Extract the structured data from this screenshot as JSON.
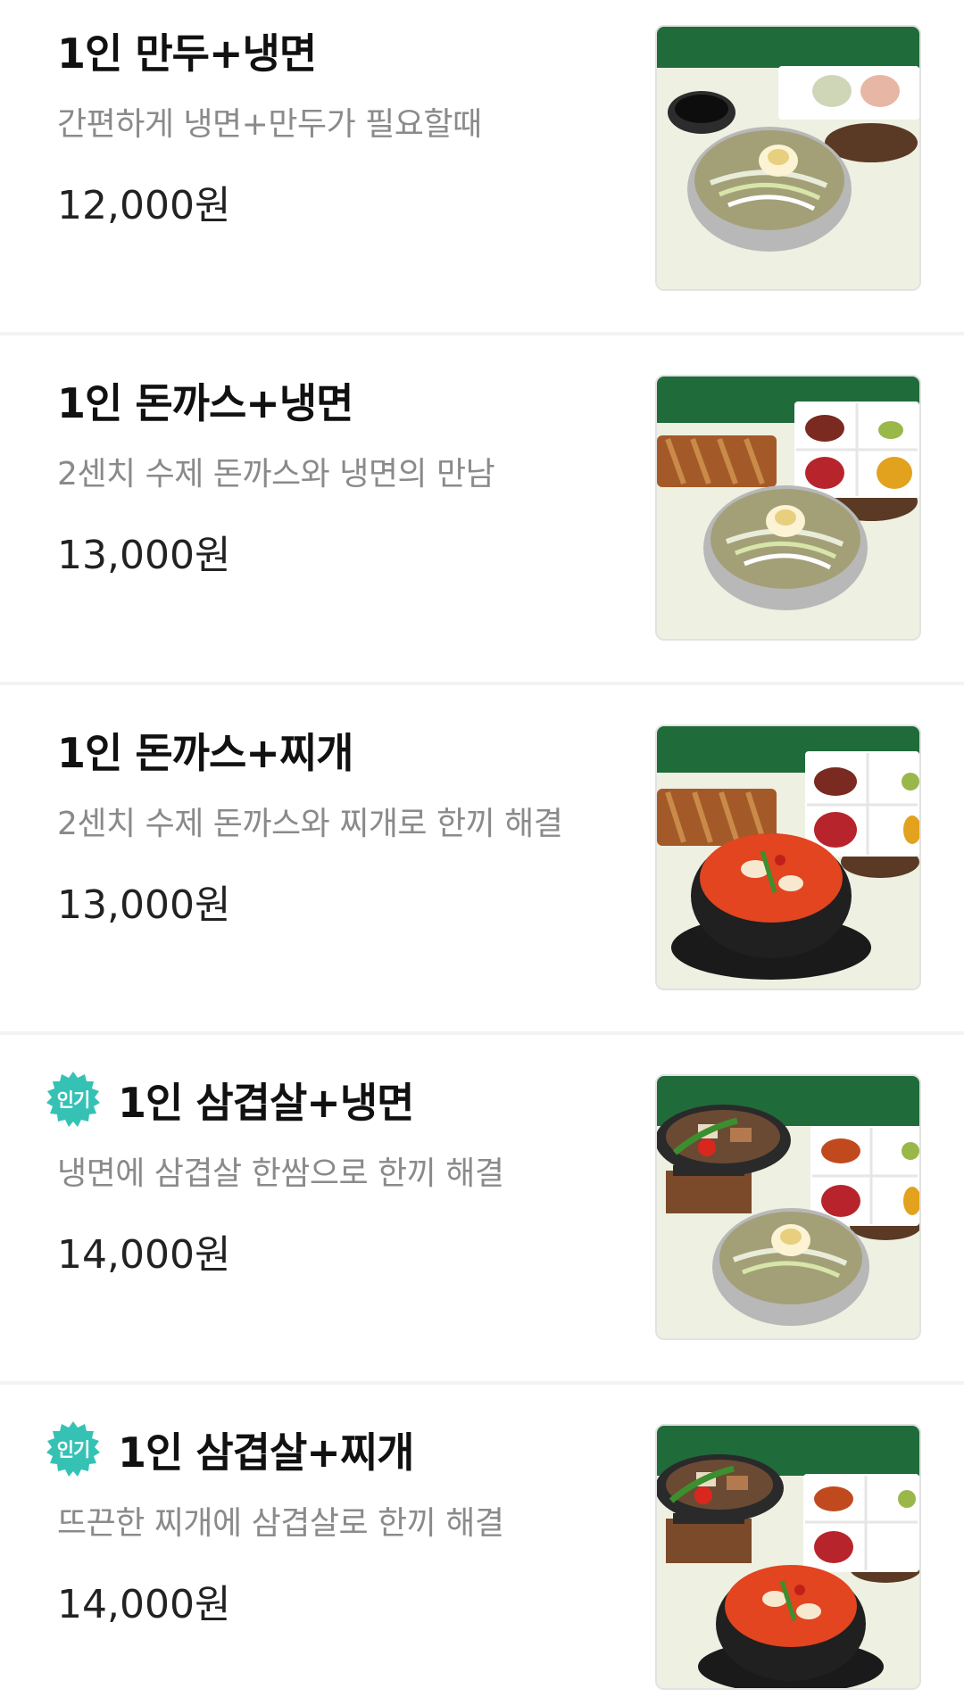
{
  "menu": {
    "items": [
      {
        "name": "1인 만두+냉면",
        "description": "간편하게 냉면+만두가 필요할때",
        "price": "12,000원",
        "badge": null,
        "image_alt": "만두와 냉면 세트 사진"
      },
      {
        "name": "1인 돈까스+냉면",
        "description": "2센치 수제 돈까스와 냉면의 만남",
        "price": "13,000원",
        "badge": null,
        "image_alt": "돈까스와 냉면 세트 사진"
      },
      {
        "name": "1인 돈까스+찌개",
        "description": "2센치 수제 돈까스와  찌개로 한끼 해결",
        "price": "13,000원",
        "badge": null,
        "image_alt": "돈까스와 찌개 세트 사진"
      },
      {
        "name": "1인 삼겹살+냉면",
        "description": "냉면에 삼겹살 한쌈으로 한끼 해결",
        "price": "14,000원",
        "badge": "인기",
        "image_alt": "삼겹살과 냉면 세트 사진"
      },
      {
        "name": "1인 삼겹살+찌개",
        "description": "뜨끈한 찌개에 삼겹살로 한끼 해결",
        "price": "14,000원",
        "badge": "인기",
        "image_alt": "삼겹살과 찌개 세트 사진"
      }
    ]
  },
  "colors": {
    "badge": "#35c2b5",
    "name": "#111111",
    "description": "#8a8a8a",
    "price": "#222222",
    "divider": "#f3f3f3",
    "photo_backdrop_green": "#1f6b3a",
    "photo_table": "#eef0e2"
  }
}
